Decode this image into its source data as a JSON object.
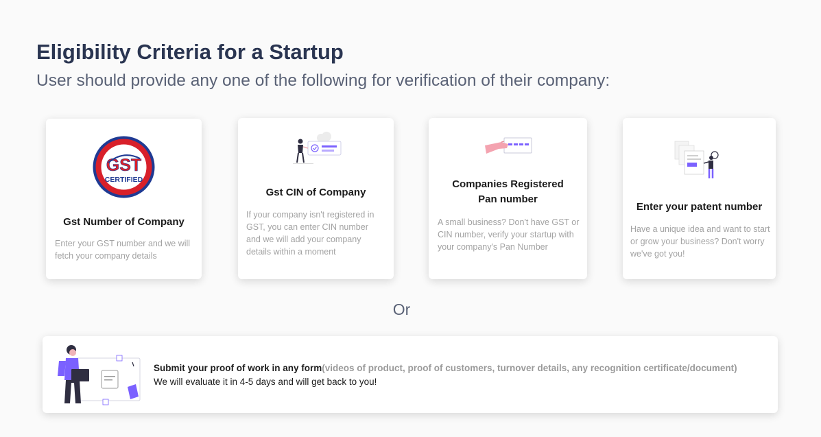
{
  "header": {
    "title": "Eligibility Criteria for a Startup",
    "subtitle": "User should provide any one of the following for verification of their company:"
  },
  "cards": [
    {
      "title": "Gst Number of Company",
      "description": "Enter your GST number and we will fetch your company details",
      "badge_top": "GST",
      "badge_bottom": "CERTIFIED"
    },
    {
      "title": "Gst CIN of Company",
      "description": "If your company isn't registered in GST, you can enter CIN number and we will add your company details within a moment"
    },
    {
      "title": "Companies Registered Pan number",
      "description": "A small business? Don't have GST or CIN number, verify your startup with your company's Pan Number"
    },
    {
      "title": "Enter your patent number",
      "description": "Have a unique idea and want to start or grow your business? Don't worry we've got you!"
    }
  ],
  "separator": "Or",
  "proof": {
    "title": "Submit your proof of work in any form",
    "details": "(videos of product, proof of customers, turnover details, any recognition certificate/document)",
    "note": "We will evaluate it in 4-5 days and will get back to you!"
  },
  "colors": {
    "accent": "#7b61ff",
    "title": "#2a3551",
    "muted": "#a3a3a3",
    "gst_red": "#d8202a",
    "gst_blue": "#1f3a93"
  }
}
